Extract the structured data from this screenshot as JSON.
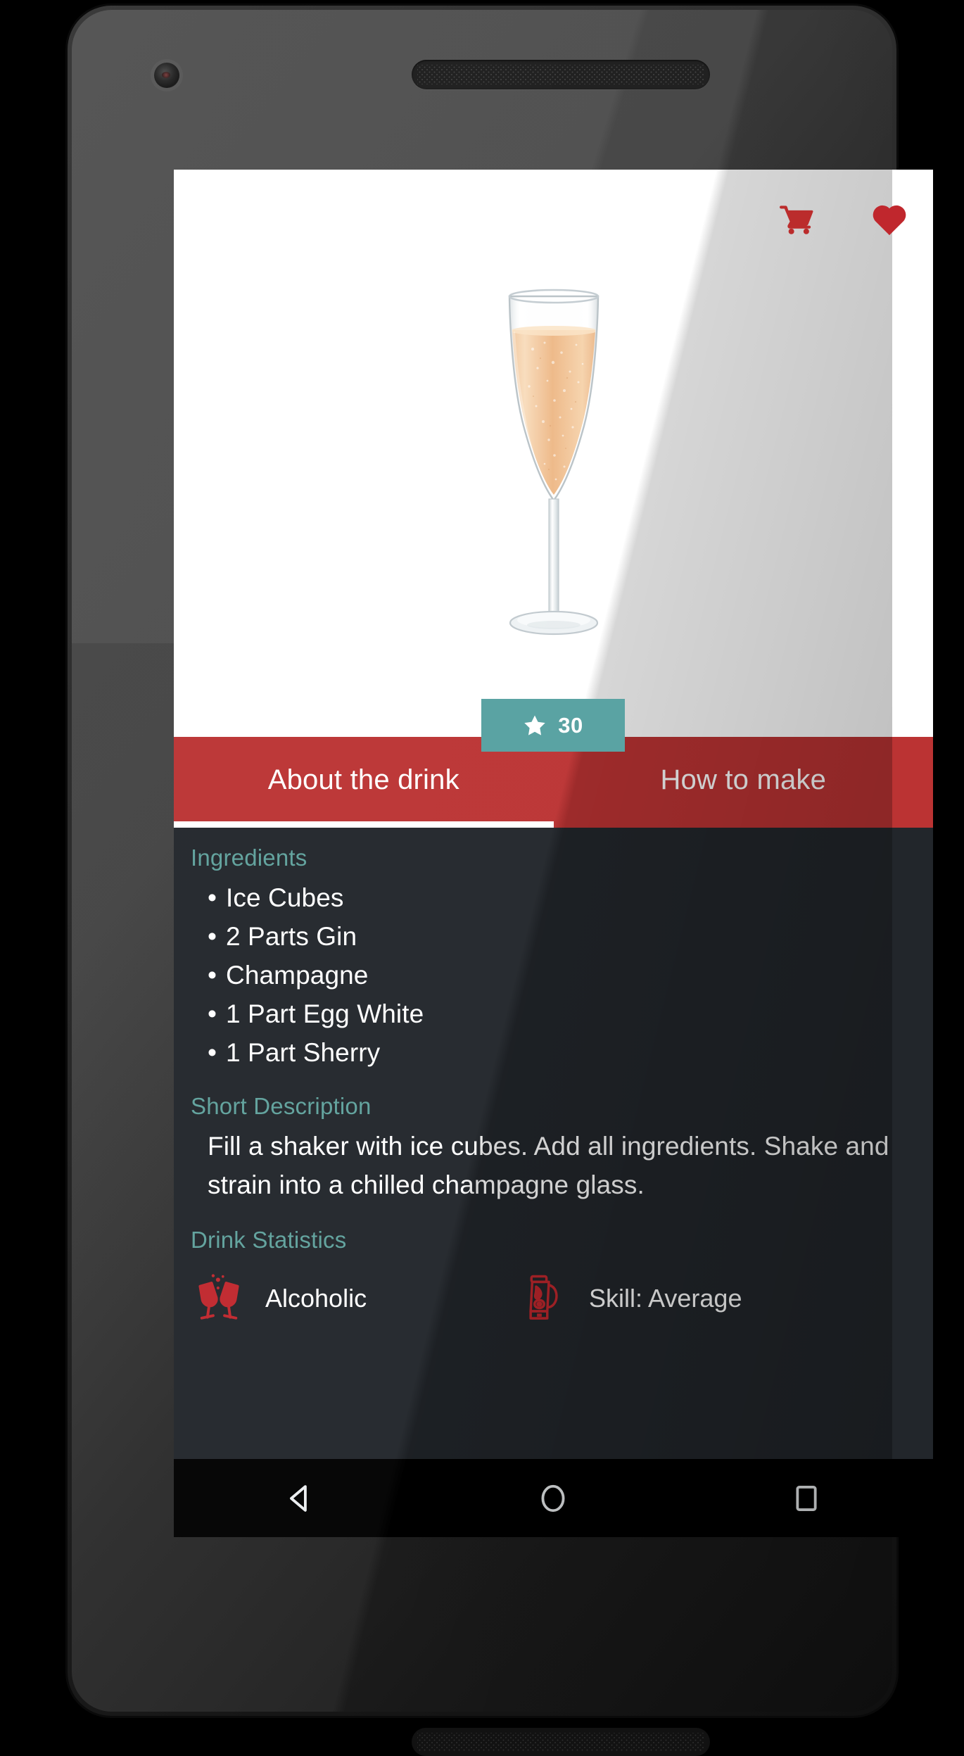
{
  "device": {
    "type": "android-phone",
    "frame_color": "#2b2b2b"
  },
  "app": {
    "screen_name": "Drink Detail",
    "actions": [
      {
        "name": "cart-icon",
        "label": "Shopping Cart",
        "color": "#bb2c2c"
      },
      {
        "name": "favorite-icon",
        "label": "Favorite",
        "color": "#c0272d",
        "active": true
      }
    ],
    "hero": {
      "image_name": "champagne-flute-image",
      "image_alt": "Champagne flute filled with sparkling golden wine",
      "background": "#ffffff"
    },
    "rating": {
      "icon": "star-icon",
      "value": "30",
      "background": "#5aa3a3",
      "text_color": "#ffffff"
    },
    "tabs": [
      {
        "label": "About the drink",
        "active": true
      },
      {
        "label": "How to make",
        "active": false
      }
    ],
    "tabbar": {
      "background": "#bb3333",
      "indicator_color": "#ffffff"
    },
    "sections": {
      "ingredients": {
        "heading": "Ingredients",
        "items": [
          "Ice Cubes",
          "2 Parts Gin",
          "Champagne",
          "1 Part Egg White",
          "1 Part Sherry"
        ]
      },
      "short_description": {
        "heading": "Short Description",
        "text": "Fill a shaker with ice cubes. Add all ingredients. Shake and strain into a chilled champagne glass."
      },
      "drink_statistics": {
        "heading": "Drink Statistics",
        "items": [
          {
            "icon": "cheers-glasses-icon",
            "label": "Alcoholic"
          },
          {
            "icon": "blender-icon",
            "label": "Skill: Average"
          }
        ]
      }
    },
    "theme": {
      "content_background": "#22262b",
      "heading_color": "#5fa19c",
      "body_text_color": "#ffffff",
      "accent_red": "#bb3333",
      "accent_teal": "#5aa3a3"
    }
  },
  "navbar": {
    "background": "#000000",
    "buttons": [
      {
        "name": "back-button",
        "icon": "triangle-left-icon"
      },
      {
        "name": "home-button",
        "icon": "circle-icon"
      },
      {
        "name": "recents-button",
        "icon": "square-icon"
      }
    ]
  }
}
